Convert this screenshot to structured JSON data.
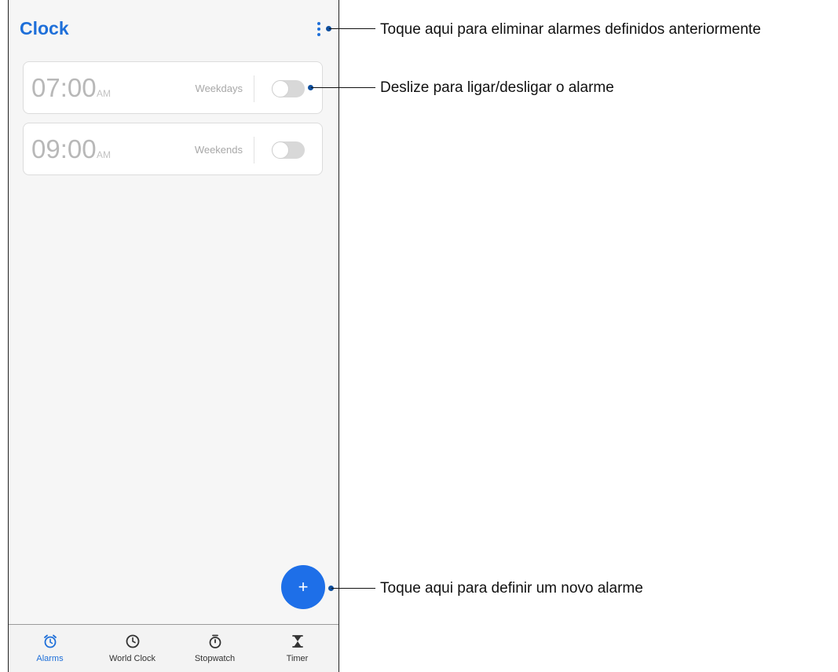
{
  "app": {
    "title": "Clock"
  },
  "alarms": [
    {
      "time": "07:00",
      "ampm": "AM",
      "days": "Weekdays",
      "enabled": false
    },
    {
      "time": "09:00",
      "ampm": "AM",
      "days": "Weekends",
      "enabled": false
    }
  ],
  "fab": {
    "label": "+"
  },
  "nav": {
    "items": [
      {
        "label": "Alarms",
        "icon": "alarm-icon",
        "active": true
      },
      {
        "label": "World Clock",
        "icon": "world-clock-icon",
        "active": false
      },
      {
        "label": "Stopwatch",
        "icon": "stopwatch-icon",
        "active": false
      },
      {
        "label": "Timer",
        "icon": "hourglass-icon",
        "active": false
      }
    ]
  },
  "callouts": [
    {
      "text": "Toque aqui para eliminar alarmes definidos anteriormente"
    },
    {
      "text": "Deslize para ligar/desligar o alarme"
    },
    {
      "text": "Toque aqui para definir um novo alarme"
    }
  ],
  "colors": {
    "accent": "#1e6fd9",
    "fab": "#1e6fe8",
    "callout_dot": "#0e4f9e"
  }
}
